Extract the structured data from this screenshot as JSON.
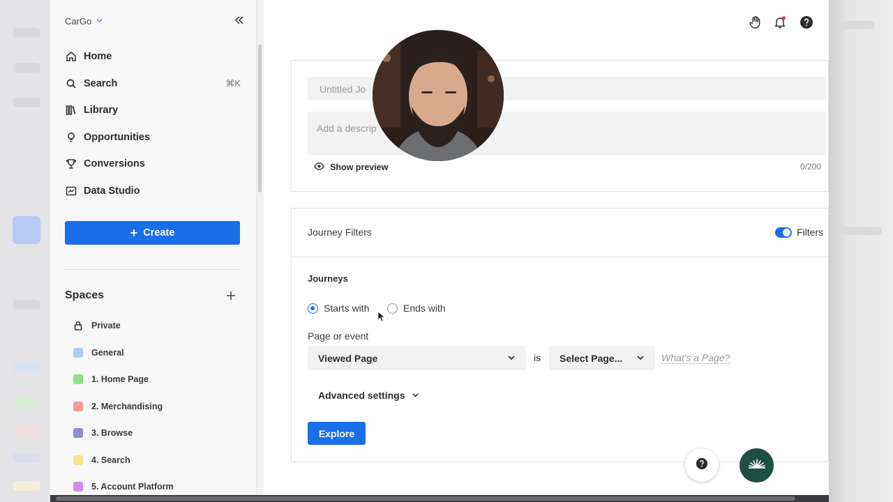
{
  "sidebar": {
    "org_name": "CarGo",
    "nav": [
      {
        "label": "Home",
        "icon": "home-icon"
      },
      {
        "label": "Search",
        "icon": "search-icon",
        "shortcut": "⌘K"
      },
      {
        "label": "Library",
        "icon": "library-icon"
      },
      {
        "label": "Opportunities",
        "icon": "lightbulb-icon"
      },
      {
        "label": "Conversions",
        "icon": "trophy-icon"
      },
      {
        "label": "Data Studio",
        "icon": "chart-icon"
      }
    ],
    "create_label": "Create",
    "spaces_title": "Spaces",
    "spaces": [
      {
        "label": "Private",
        "color": ""
      },
      {
        "label": "General",
        "color": "#a8cdf7"
      },
      {
        "label": "1. Home Page",
        "color": "#8fdf8a"
      },
      {
        "label": "2. Merchandising",
        "color": "#f39c9a"
      },
      {
        "label": "3. Browse",
        "color": "#8a8dcf"
      },
      {
        "label": "4. Search",
        "color": "#fbe08f"
      },
      {
        "label": "5. Account Platform",
        "color": "#d58be6"
      }
    ]
  },
  "journey": {
    "title_placeholder": "Untitled Jo",
    "description_placeholder": "Add a descrip",
    "show_preview_label": "Show preview",
    "char_count": "0/200"
  },
  "filters": {
    "section_title": "Journey Filters",
    "toggle_label": "Filters",
    "journeys_label": "Journeys",
    "radio_starts": "Starts with",
    "radio_ends": "Ends with",
    "page_or_event_label": "Page or event",
    "page_event_value": "Viewed Page",
    "is_label": "is",
    "select_page_value": "Select Page...",
    "whats_page_link": "What's a Page?",
    "advanced_label": "Advanced settings",
    "explore_label": "Explore"
  },
  "colors": {
    "accent": "#1a6fe8",
    "brand": "#1f4f43",
    "notification_dot": "#e8344e"
  }
}
